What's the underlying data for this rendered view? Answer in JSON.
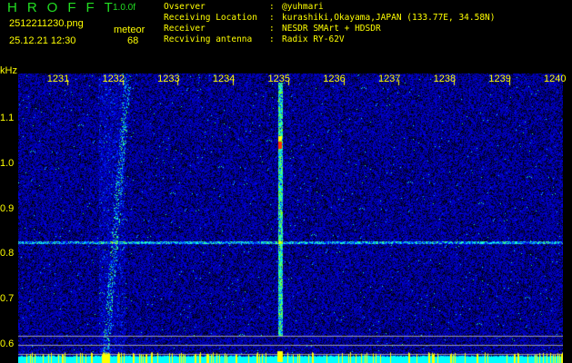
{
  "header": {
    "logo": "HROFFT",
    "version": "1.0.0f",
    "filename": "2512211230.png",
    "datetime": "25.12.21 12:30",
    "meteor_label": "meteor",
    "meteor_count": "68",
    "info": [
      {
        "label": "Ovserver",
        "value": "@yuhmari"
      },
      {
        "label": "Receiving Location",
        "value": "kurashiki,Okayama,JAPAN (133.77E, 34.58N)"
      },
      {
        "label": "Receiver",
        "value": "NESDR SMArt + HDSDR"
      },
      {
        "label": "Recviving antenna",
        "value": "Radix RY-62V"
      }
    ]
  },
  "plot": {
    "y_unit": "kHz",
    "x_ticks": [
      "1231",
      "1232",
      "1233",
      "1234",
      "1235",
      "1236",
      "1237",
      "1238",
      "1239",
      "1240"
    ],
    "y_ticks": [
      "1.1",
      "1.0",
      "0.9",
      "0.8",
      "0.7",
      "0.6"
    ],
    "colors": {
      "text": "#ffff00",
      "spectrum": "#00ffff",
      "peak": "#ffff00",
      "grid": "#a0a0a0"
    }
  }
}
